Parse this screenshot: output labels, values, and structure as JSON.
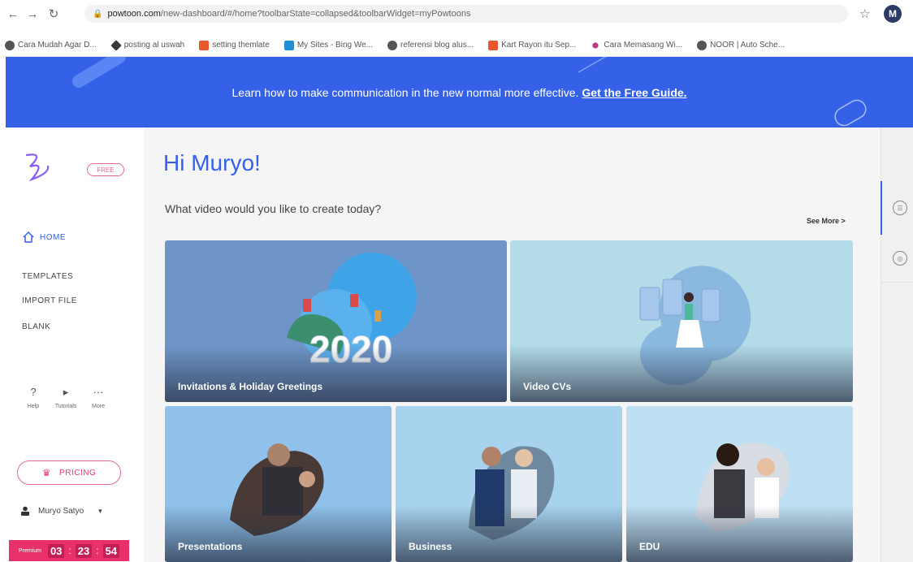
{
  "browser": {
    "url_domain": "powtoon.com",
    "url_path": "/new-dashboard/#/home?toolbarState=collapsed&toolbarWidget=myPowtoons",
    "profile_initial": "M",
    "bookmarks": [
      {
        "label": "Cara Mudah Agar D...",
        "color": "#555555"
      },
      {
        "label": "posting al uswah",
        "color": "#3a3a3a"
      },
      {
        "label": "setting themlate",
        "color": "#e8572b"
      },
      {
        "label": "My Sites - Bing We...",
        "color": "#1f8fd6"
      },
      {
        "label": "referensi blog alus...",
        "color": "#555555"
      },
      {
        "label": "Kart Rayon itu Sep...",
        "color": "#e8572b"
      },
      {
        "label": "Cara Memasang Wi...",
        "color": "#c2338a"
      },
      {
        "label": "NOOR | Auto Sche...",
        "color": "#555555"
      }
    ]
  },
  "banner": {
    "text": "Learn how to make communication in the new normal more effective.",
    "link": "Get the Free Guide."
  },
  "sidebar": {
    "free_badge": "FREE",
    "nav": [
      {
        "label": "HOME",
        "active": true
      },
      {
        "label": "TEMPLATES"
      },
      {
        "label": "IMPORT FILE"
      },
      {
        "label": "BLANK"
      }
    ],
    "utilities": [
      {
        "label": "Help",
        "icon": "?"
      },
      {
        "label": "Tutorials",
        "icon": "▸"
      },
      {
        "label": "More",
        "icon": "···"
      }
    ],
    "pricing": "PRICING",
    "user_name": "Muryo Satyo",
    "premium_label": "Premium",
    "timer": [
      "03",
      "23",
      "54"
    ]
  },
  "main": {
    "greeting": "Hi Muryo!",
    "subtitle": "What video would you like to create today?",
    "see_more": "See More >",
    "cards": [
      {
        "label": "Invitations & Holiday Greetings",
        "overlay": "2020"
      },
      {
        "label": "Video CVs"
      },
      {
        "label": "Presentations"
      },
      {
        "label": "Business"
      },
      {
        "label": "EDU"
      }
    ]
  },
  "colors": {
    "brand_blue": "#3461e8",
    "pink": "#e8316b"
  }
}
